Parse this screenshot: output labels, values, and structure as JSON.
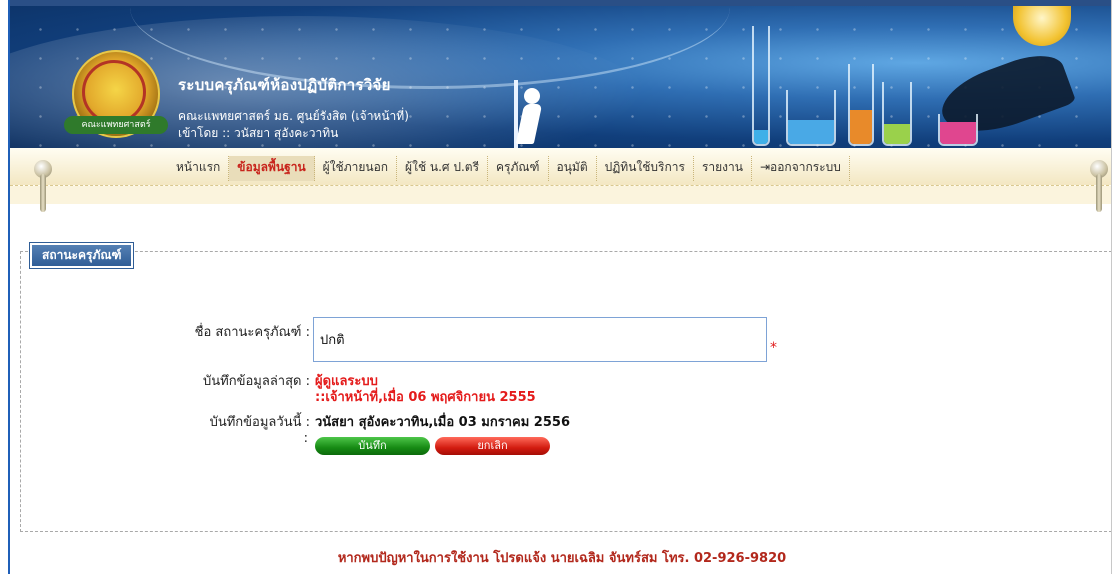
{
  "header": {
    "logo_text": "คณะแพทยศาสตร์",
    "app_title": "ระบบครุภัณฑ์ห้องปฏิบัติการวิจัย",
    "subtitle": "คณะแพทยศาสตร์ มธ. ศูนย์รังสิต (เจ้าหน้าที่)",
    "login_as": "เข้าโดย :: วนัสยา สุอังคะวาทิน"
  },
  "nav": {
    "items": [
      {
        "label": "หน้าแรก",
        "active": false
      },
      {
        "label": "ข้อมูลพื้นฐาน",
        "active": true
      },
      {
        "label": "ผู้ใช้ภายนอก",
        "active": false
      },
      {
        "label": "ผู้ใช้ น.ศ ป.ตรี",
        "active": false
      },
      {
        "label": "ครุภัณฑ์",
        "active": false
      },
      {
        "label": "อนุมัติ",
        "active": false
      },
      {
        "label": "ปฏิทินใช้บริการ",
        "active": false
      },
      {
        "label": "รายงาน",
        "active": false
      },
      {
        "label": "ออกจากระบบ",
        "active": false
      }
    ]
  },
  "form": {
    "legend": "สถานะครุภัณฑ์",
    "name_label": "ชื่อ สถานะครุภัณฑ์ :",
    "name_value": "ปกติ",
    "required_mark": "*",
    "last_saved_label": "บันทึกข้อมูลล่าสุด :",
    "last_saved_by": "ผู้ดูแลระบบ",
    "last_saved_detail": "::เจ้าหน้าที่,เมื่อ 06 พฤศจิกายน 2555",
    "today_label": "บันทึกข้อมูลวันนี้ :",
    "today_value": "วนัสยา สุอังคะวาทิน,เมื่อ 03 มกราคม 2556",
    "buttons_colon": ":",
    "save_label": "บันทึก",
    "cancel_label": "ยกเลิก"
  },
  "footer": {
    "text": "หากพบปัญหาในการใช้งาน โปรดแจ้ง นายเฉลิม จันทร์สม โทร. 02-926-9820"
  },
  "colors": {
    "accent_red": "#e41b1b",
    "save_green": "#168a14",
    "cancel_red": "#d31c10",
    "legend_blue": "#2f5d96"
  }
}
